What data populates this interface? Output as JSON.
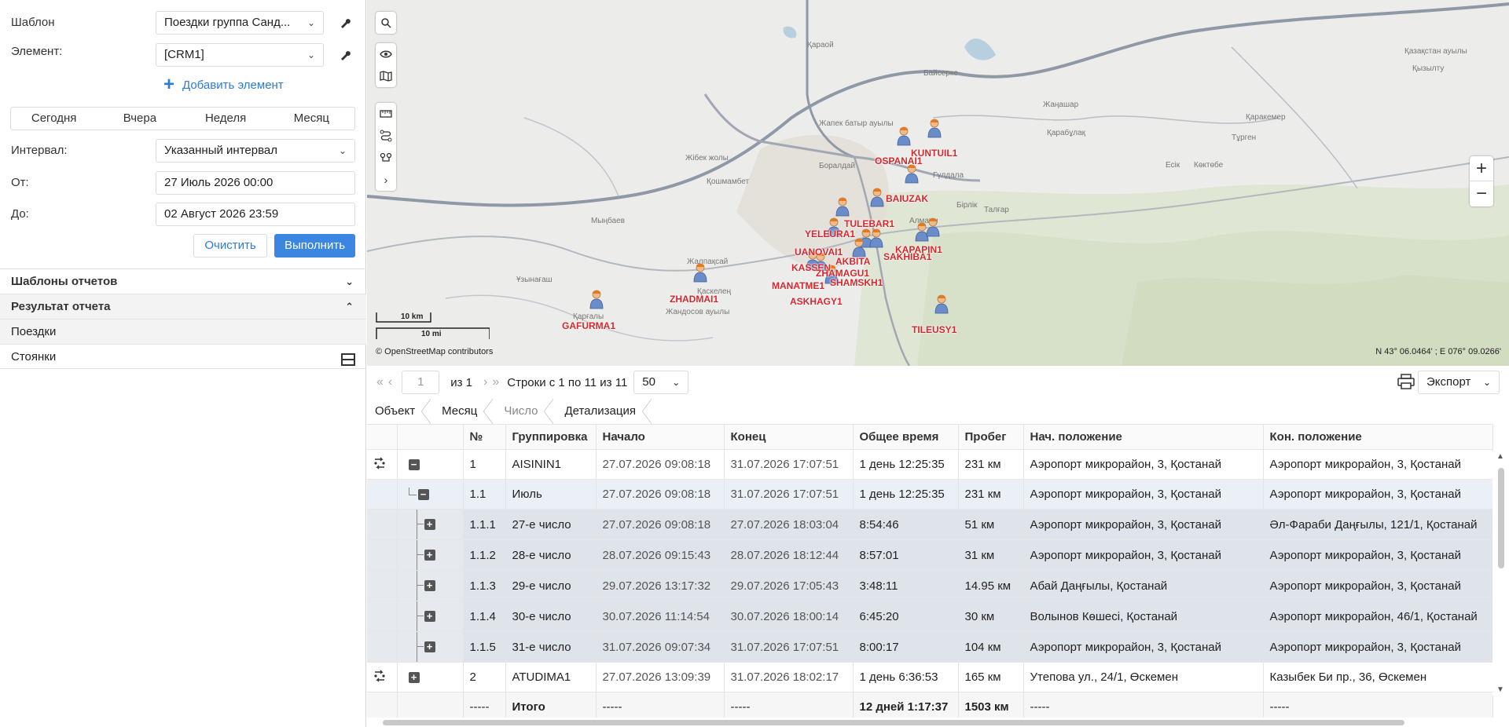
{
  "form": {
    "template_label": "Шаблон",
    "template_value": "Поездки группа Санд...",
    "element_label": "Элемент:",
    "element_value": "[CRM1]",
    "add_element": "Добавить элемент",
    "quick_ranges": [
      "Сегодня",
      "Вчера",
      "Неделя",
      "Месяц"
    ],
    "interval_label": "Интервал:",
    "interval_value": "Указанный интервал",
    "from_label": "От:",
    "from_value": "27 Июль 2026 00:00",
    "to_label": "До:",
    "to_value": "02 Август 2026 23:59",
    "clear_button": "Очистить",
    "run_button": "Выполнить"
  },
  "sections": {
    "templates": "Шаблоны отчетов",
    "result": "Результат отчета",
    "trips": "Поездки",
    "stops": "Стоянки"
  },
  "map": {
    "place_labels": [
      {
        "text": "Қараой"
      },
      {
        "text": "Жапек батыр ауылы"
      },
      {
        "text": "Жібек жолы"
      },
      {
        "text": "Қошмамбет"
      },
      {
        "text": "Боралдай"
      },
      {
        "text": "Мыңбаев"
      },
      {
        "text": "Жалпақсай"
      },
      {
        "text": "Ұзынағаш"
      },
      {
        "text": "Қарғалы"
      },
      {
        "text": "Жандосов ауылы"
      },
      {
        "text": "Қаскелең"
      },
      {
        "text": "Байсерке"
      },
      {
        "text": "Жаңашар"
      },
      {
        "text": "Қарабұлақ"
      },
      {
        "text": "Тұрген"
      },
      {
        "text": "Қаракемер"
      },
      {
        "text": "Есік"
      },
      {
        "text": "Көктөбе"
      },
      {
        "text": "Бірлік"
      },
      {
        "text": "Талғар"
      },
      {
        "text": "Гүлдала"
      },
      {
        "text": "Қазақстан ауылы"
      },
      {
        "text": "Қызылту"
      },
      {
        "text": "Алматы"
      }
    ],
    "units": [
      {
        "name": "KUNTUIL1"
      },
      {
        "name": "OSPANAI1"
      },
      {
        "name": "BAIUZAK"
      },
      {
        "name": "TULEBAR1"
      },
      {
        "name": "YELEURA1"
      },
      {
        "name": "UANOVAI1"
      },
      {
        "name": "KASSEN"
      },
      {
        "name": "AKBITA"
      },
      {
        "name": "SAKHIBA1"
      },
      {
        "name": "KAPAPIN1"
      },
      {
        "name": "ZHAMAGU1"
      },
      {
        "name": "SHAMSKH1"
      },
      {
        "name": "MANATME1"
      },
      {
        "name": "ASKHAGY1"
      },
      {
        "name": "ZHADMAI1"
      },
      {
        "name": "GAFURMA1"
      },
      {
        "name": "TILEUSY1"
      }
    ],
    "scale_km": "10 km",
    "scale_mi": "10 mi",
    "attribution": "© OpenStreetMap contributors",
    "coords": "N 43° 06.0464' ; E 076° 09.0266'",
    "zoom_in": "+",
    "zoom_out": "−"
  },
  "pager": {
    "page": "1",
    "of": "из 1",
    "rows_info": "Строки с 1 по 11 из 11",
    "page_size": "50",
    "export": "Экспорт"
  },
  "crumbs": [
    "Объект",
    "Месяц",
    "Число",
    "Детализация"
  ],
  "table": {
    "headers": [
      "№",
      "Группировка",
      "Начало",
      "Конец",
      "Общее время",
      "Пробег",
      "Нач. положение",
      "Кон. положение"
    ],
    "rows": [
      {
        "level": 0,
        "num": "1",
        "group": "AISININ1",
        "start": "27.07.2026 09:08:18",
        "end": "31.07.2026 17:07:51",
        "total": "1 день 12:25:35",
        "mileage": "231 км",
        "from": "Аэропорт микрорайон, 3, Қостанай",
        "to": "Аэропорт микрорайон, 3, Қостанай"
      },
      {
        "level": 1,
        "num": "1.1",
        "group": "Июль",
        "start": "27.07.2026 09:08:18",
        "end": "31.07.2026 17:07:51",
        "total": "1 день 12:25:35",
        "mileage": "231 км",
        "from": "Аэропорт микрорайон, 3, Қостанай",
        "to": "Аэропорт микрорайон, 3, Қостанай"
      },
      {
        "level": 2,
        "num": "1.1.1",
        "group": "27-е число",
        "start": "27.07.2026 09:08:18",
        "end": "27.07.2026 18:03:04",
        "total": "8:54:46",
        "mileage": "51 км",
        "from": "Аэропорт микрорайон, 3, Қостанай",
        "to": "Әл-Фараби Даңғылы, 121/1, Қостанай"
      },
      {
        "level": 2,
        "num": "1.1.2",
        "group": "28-е число",
        "start": "28.07.2026 09:15:43",
        "end": "28.07.2026 18:12:44",
        "total": "8:57:01",
        "mileage": "31 км",
        "from": "Аэропорт микрорайон, 3, Қостанай",
        "to": "Аэропорт микрорайон, 3, Қостанай"
      },
      {
        "level": 2,
        "num": "1.1.3",
        "group": "29-е число",
        "start": "29.07.2026 13:17:32",
        "end": "29.07.2026 17:05:43",
        "total": "3:48:11",
        "mileage": "14.95 км",
        "from": "Абай Даңғылы, Қостанай",
        "to": "Аэропорт микрорайон, 3, Қостанай"
      },
      {
        "level": 2,
        "num": "1.1.4",
        "group": "30-е число",
        "start": "30.07.2026 11:14:54",
        "end": "30.07.2026 18:00:14",
        "total": "6:45:20",
        "mileage": "30 км",
        "from": "Волынов Көшесі, Қостанай",
        "to": "Аэропорт микрорайон, 46/1, Қостанай"
      },
      {
        "level": 2,
        "num": "1.1.5",
        "group": "31-е число",
        "start": "31.07.2026 09:07:34",
        "end": "31.07.2026 17:07:51",
        "total": "8:00:17",
        "mileage": "104 км",
        "from": "Аэропорт микрорайон, 3, Қостанай",
        "to": "Аэропорт микрорайон, 3, Қостанай"
      },
      {
        "level": 0,
        "num": "2",
        "group": "ATUDIMA1",
        "start": "27.07.2026 13:09:39",
        "end": "31.07.2026 18:02:17",
        "total": "1 день 6:36:53",
        "mileage": "165 км",
        "from": "Утепова ул., 24/1, Өскемен",
        "to": "Казыбек Би пр., 36, Өскемен"
      }
    ],
    "total": {
      "num": "-----",
      "group": "Итого",
      "start": "-----",
      "end": "-----",
      "total": "12 дней 1:17:37",
      "mileage": "1503 км",
      "from": "-----",
      "to": "-----"
    }
  },
  "colors": {
    "accent": "#3b86e0",
    "unit_label": "#d9262c"
  }
}
